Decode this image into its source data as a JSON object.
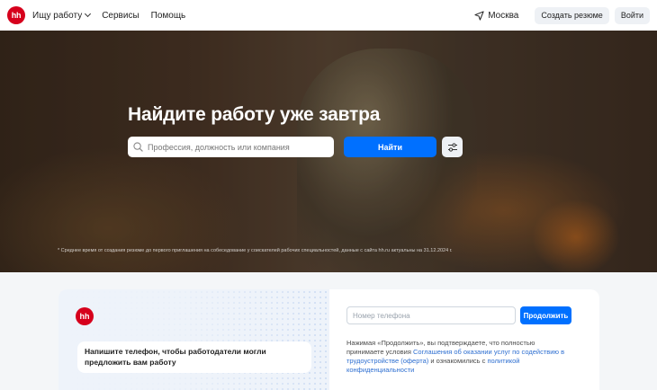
{
  "header": {
    "logo_text": "hh",
    "nav": {
      "job_search": "Ищу работу",
      "services": "Сервисы",
      "help": "Помощь"
    },
    "city": "Москва",
    "create_resume": "Создать резюме",
    "login": "Войти"
  },
  "hero": {
    "title": "Найдите работу уже завтра",
    "search_placeholder": "Профессия, должность или компания",
    "find_button": "Найти",
    "footnote": "* Среднее время от создания резюме до первого приглашения на собеседование у соискателей рабочих специальностей, данные с сайта hh.ru актуальны на 31.12.2024 г."
  },
  "signup": {
    "logo_text": "hh",
    "message": "Напишите телефон, чтобы работодатели могли предложить вам работу",
    "phone_placeholder": "Номер телефона",
    "continue_button": "Продолжить",
    "terms_prefix": "Нажимая «Продолжить», вы подтверждаете, что полностью принимаете условия ",
    "terms_link1": "Соглашения об оказании услуг по содействию в трудоустройстве (оферта)",
    "terms_middle": " и ознакомились с ",
    "terms_link2": "политикой конфиденциальности"
  },
  "colors": {
    "brand_red": "#d6001c",
    "accent_blue": "#0070ff"
  }
}
